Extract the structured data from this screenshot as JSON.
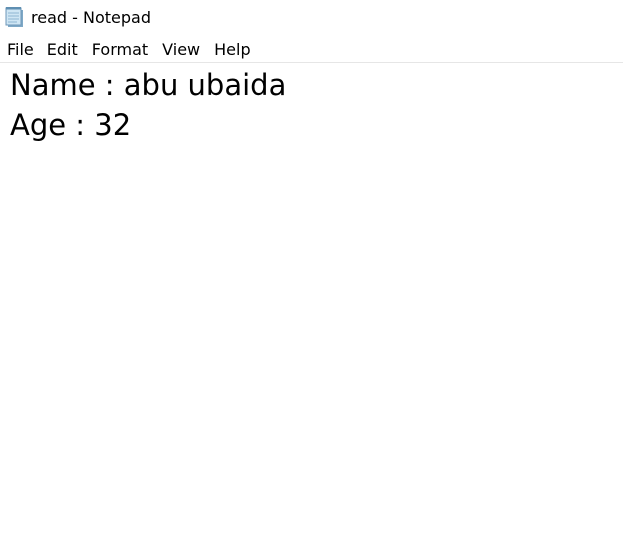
{
  "window": {
    "title": "read - Notepad",
    "icon": "notepad-icon"
  },
  "menu": {
    "items": [
      {
        "label": "File"
      },
      {
        "label": "Edit"
      },
      {
        "label": "Format"
      },
      {
        "label": "View"
      },
      {
        "label": "Help"
      }
    ]
  },
  "editor": {
    "lines": [
      "Name : abu ubaida",
      "Age : 32"
    ]
  },
  "colors": {
    "background": "#ffffff",
    "text": "#000000",
    "divider": "#e6e6e6"
  }
}
